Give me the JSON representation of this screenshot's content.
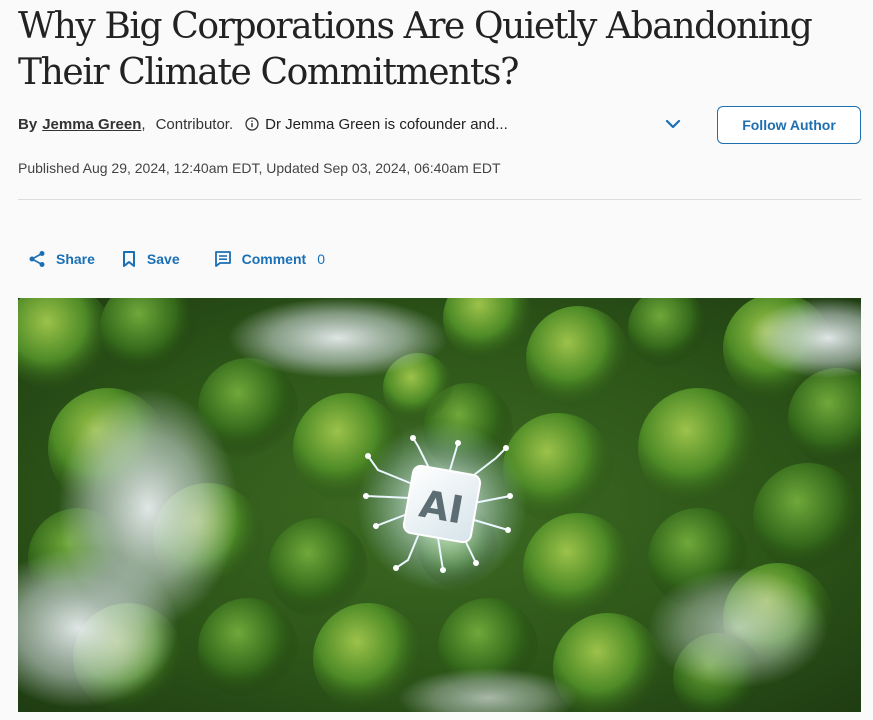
{
  "article": {
    "headline": "Why Big Corporations Are Quietly Abandoning Their Climate Commitments?",
    "byline": {
      "by": "By",
      "author": "Jemma Green",
      "comma": ",",
      "role": "Contributor.",
      "bio": "Dr Jemma Green is cofounder and..."
    },
    "follow_label": "Follow Author",
    "published": "Published Aug 29, 2024, 12:40am EDT, Updated Sep 03, 2024, 06:40am EDT"
  },
  "actions": {
    "share_label": "Share",
    "save_label": "Save",
    "comment_label": "Comment",
    "comment_count": "0"
  },
  "hero": {
    "chip_text": "AI"
  },
  "colors": {
    "accent": "#1a6fb5",
    "headline": "#222222",
    "forest": "#2f5a22"
  },
  "icons": [
    "info-icon",
    "chevron-down-icon",
    "share-icon",
    "bookmark-icon",
    "comment-icon"
  ]
}
